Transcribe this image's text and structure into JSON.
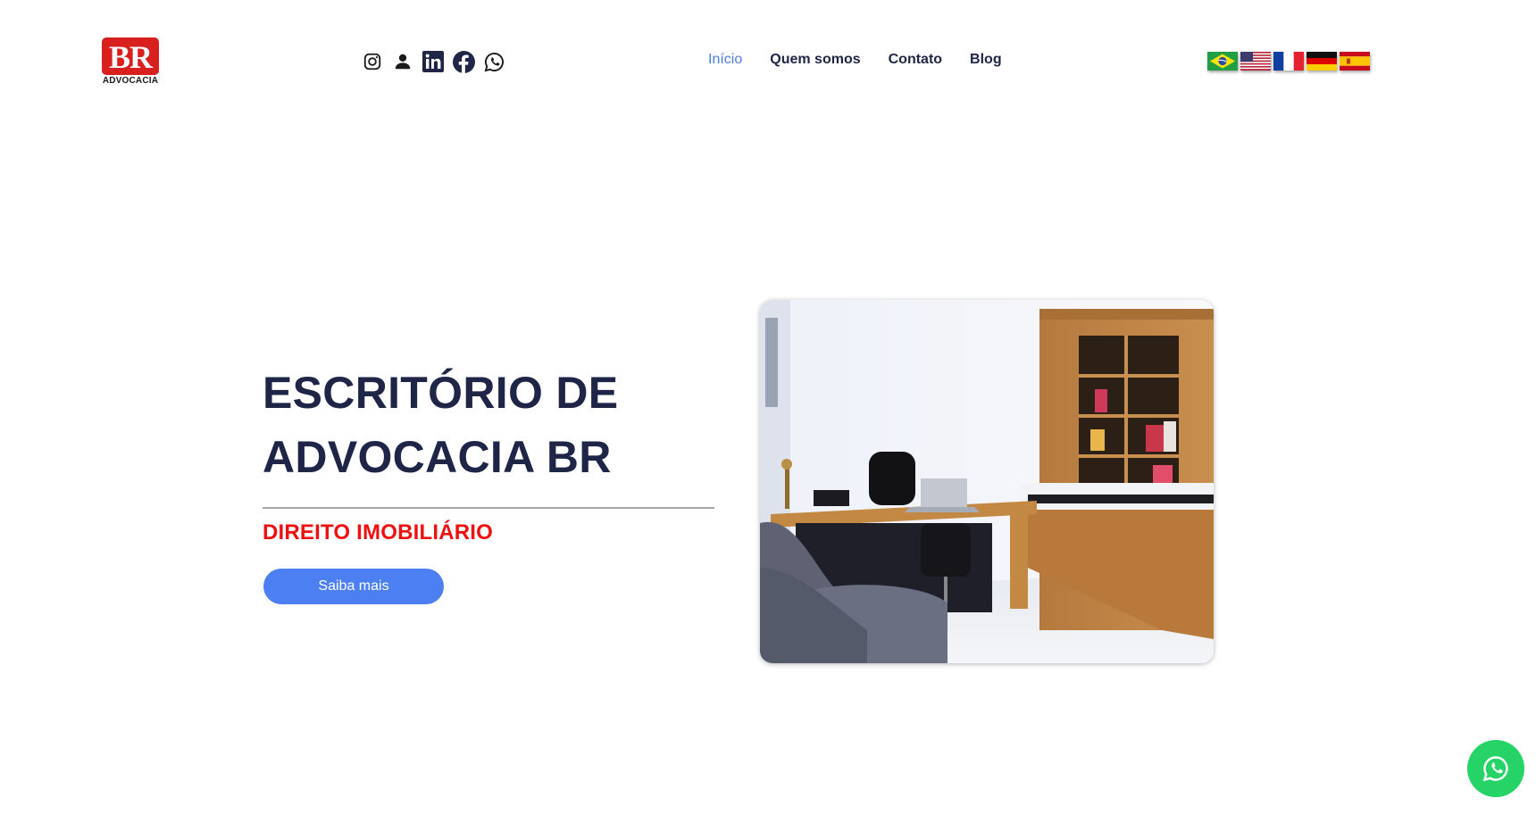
{
  "logo": {
    "mark": "BR",
    "subtitle": "ADVOCACIA",
    "color": "#d8201f"
  },
  "social_icons": [
    "instagram-icon",
    "user-icon",
    "linkedin-icon",
    "facebook-icon",
    "whatsapp-icon"
  ],
  "nav": {
    "items": [
      {
        "label": "Início",
        "active": true
      },
      {
        "label": "Quem somos",
        "active": false
      },
      {
        "label": "Contato",
        "active": false
      },
      {
        "label": "Blog",
        "active": false
      }
    ],
    "active_color": "#4a7ee6"
  },
  "languages": [
    "brazil-flag-icon",
    "usa-flag-icon",
    "france-flag-icon",
    "germany-flag-icon",
    "spain-flag-icon"
  ],
  "hero": {
    "title_line1": "ESCRITÓRIO DE",
    "title_line2": "ADVOCACIA BR",
    "subtitle": "DIREITO IMOBILIÁRIO",
    "subtitle_color": "#ee1111",
    "cta_label": "Saiba mais",
    "cta_color": "#4b7ff2",
    "image": "office-photo"
  },
  "floating_whatsapp": {
    "icon": "whatsapp-icon",
    "color": "#25d366"
  }
}
